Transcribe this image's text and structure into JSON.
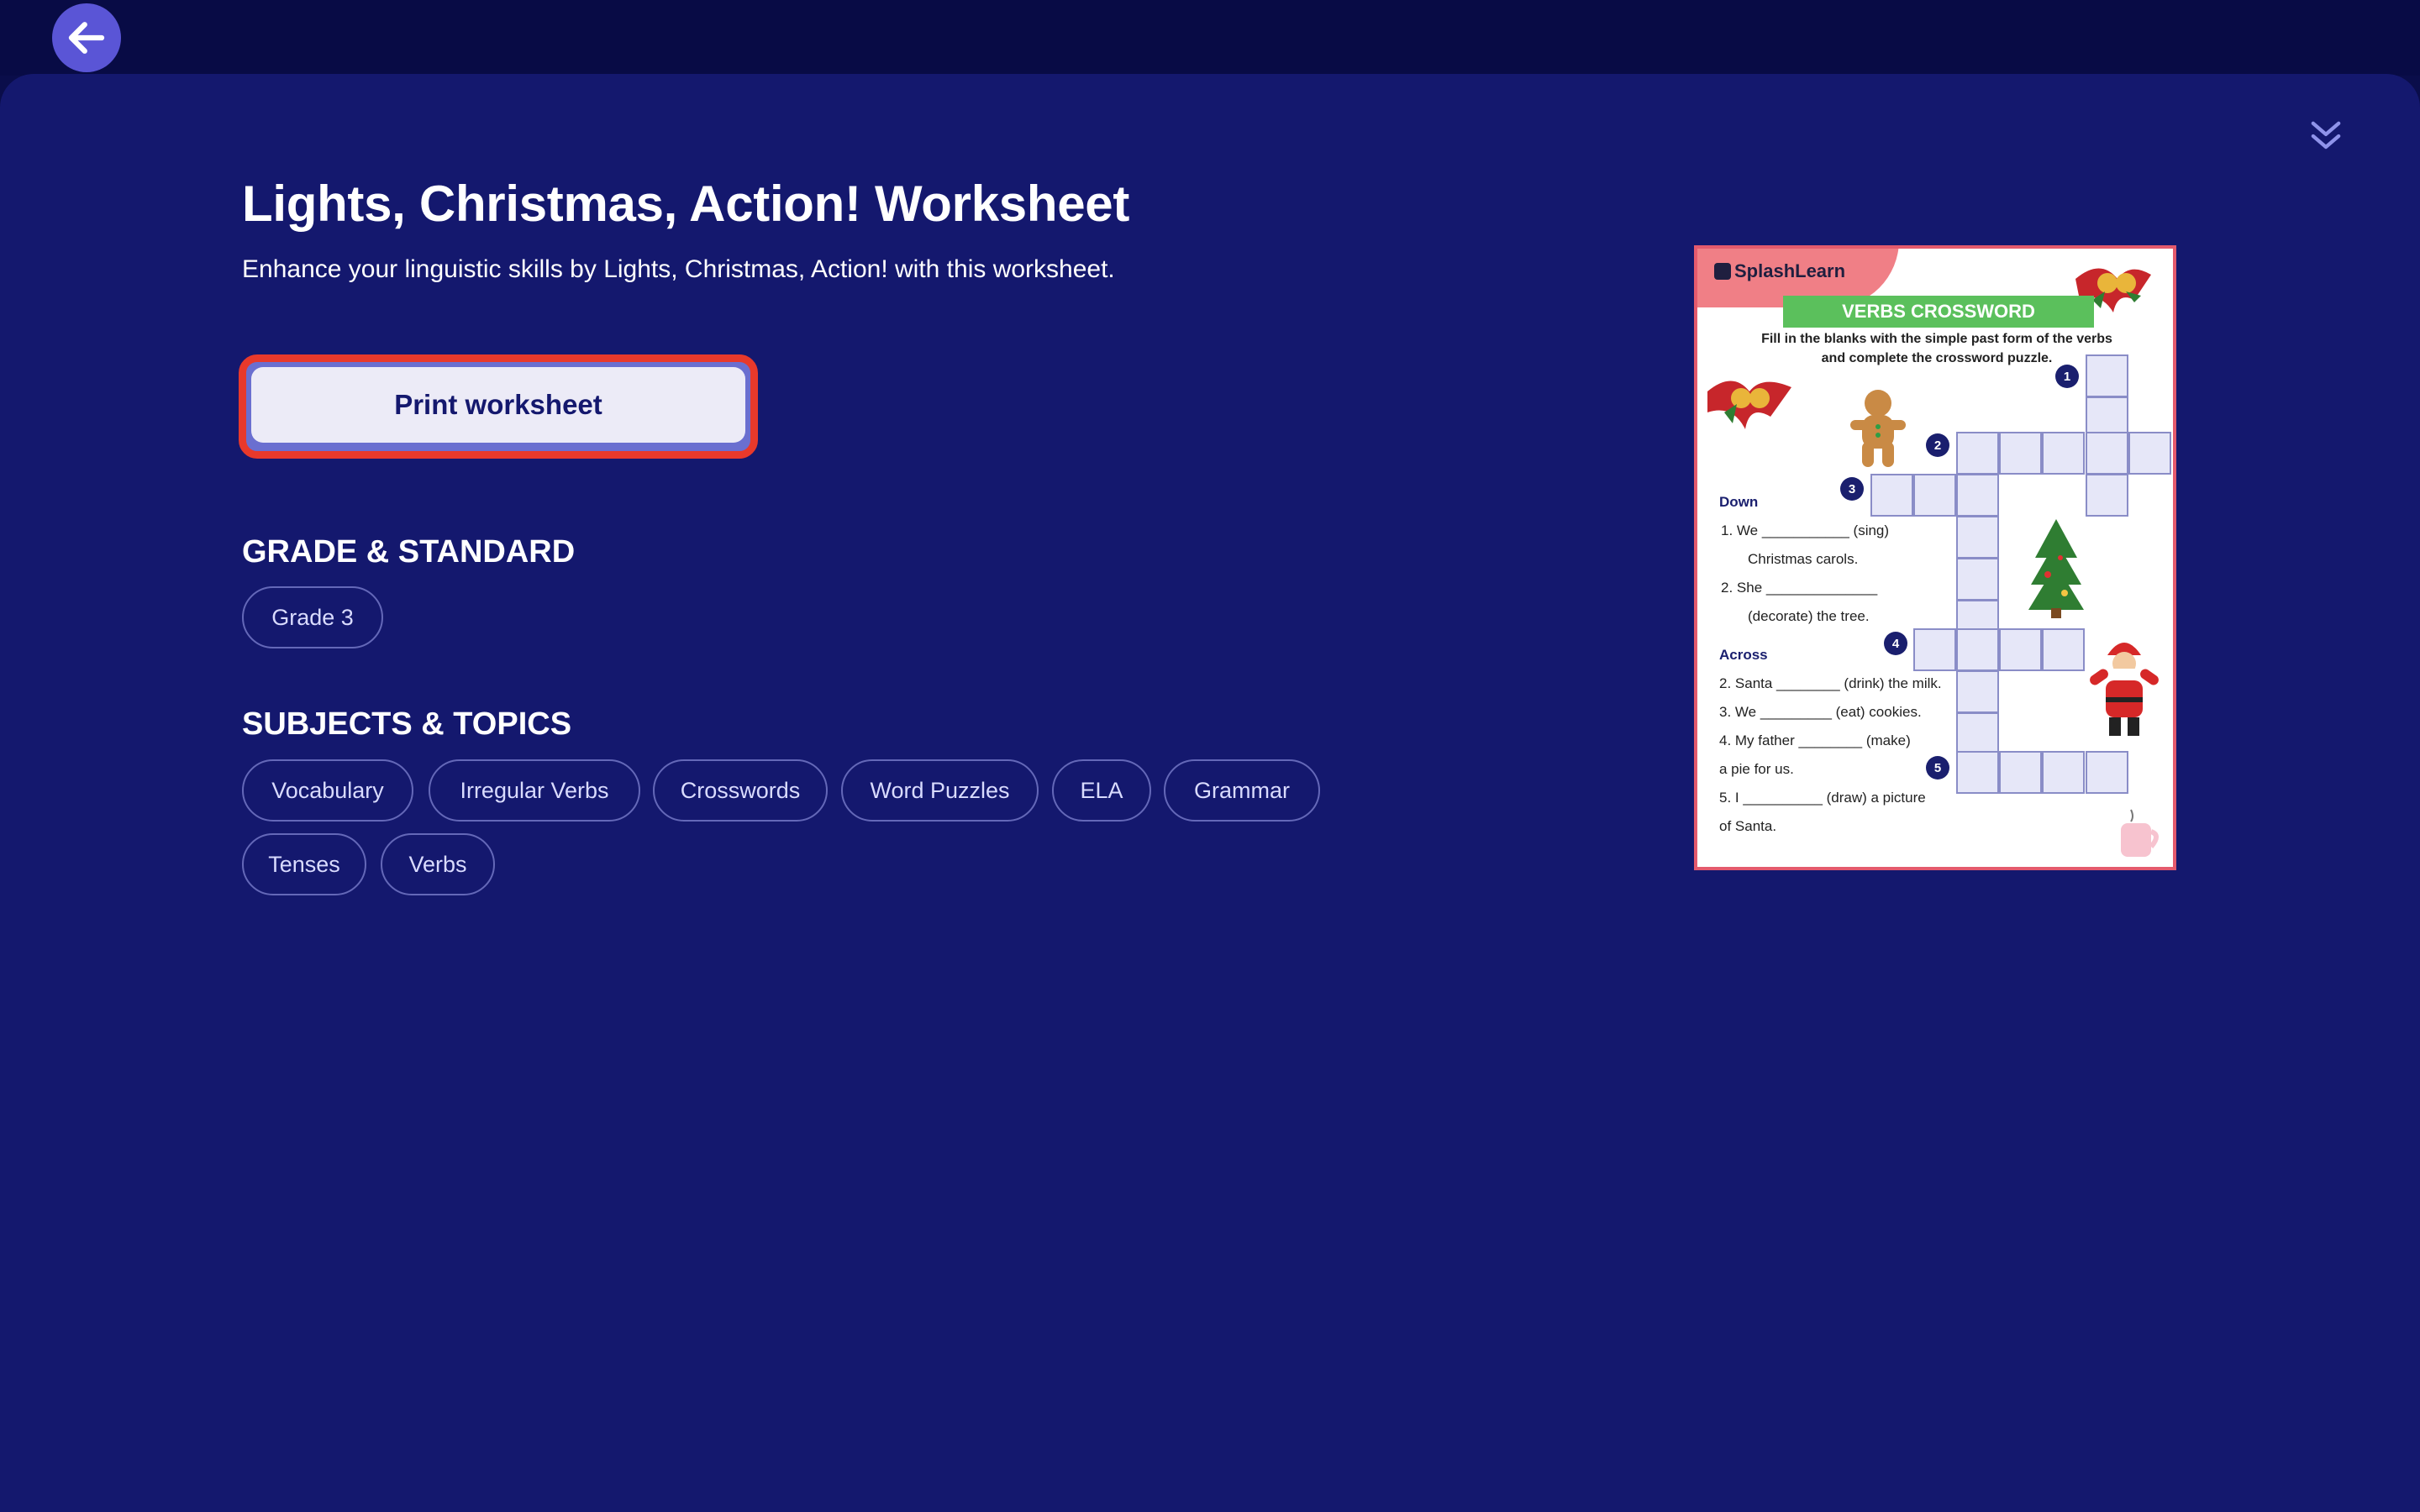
{
  "header": {
    "back_icon": "arrow-left-icon"
  },
  "panel": {
    "collapse_icon": "double-chevron-down-icon"
  },
  "worksheet": {
    "title": "Lights, Christmas, Action! Worksheet",
    "description": "Enhance your linguistic skills by Lights, Christmas, Action! with this worksheet.",
    "print_label": "Print worksheet"
  },
  "grade_section": {
    "heading": "GRADE & STANDARD",
    "chips": [
      "Grade 3"
    ]
  },
  "subjects_section": {
    "heading": "SUBJECTS & TOPICS",
    "chips": [
      "Vocabulary",
      "Irregular Verbs",
      "Crosswords",
      "Word Puzzles",
      "ELA",
      "Grammar",
      "Tenses",
      "Verbs"
    ]
  },
  "preview": {
    "brand": "SplashLearn",
    "banner": "VERBS CROSSWORD",
    "instructions": "Fill in the blanks with the simple past form of the verbs and complete the crossword puzzle.",
    "down_heading": "Down",
    "down_clues": [
      "1.   We ___________  (sing)",
      "Christmas carols.",
      "2.   She ______________",
      "(decorate) the tree."
    ],
    "across_heading": "Across",
    "across_clues": [
      "2. Santa ________ (drink) the milk.",
      "3. We _________ (eat) cookies.",
      "4. My father ________ (make)",
      "a pie for us.",
      "5. I __________ (draw) a picture",
      "of Santa."
    ],
    "numbers": [
      "1",
      "2",
      "3",
      "4",
      "5"
    ]
  },
  "colors": {
    "background": "#14186e",
    "topbar": "#080b45",
    "accent_button": "#5a55d6",
    "print_outline": "#e8392b",
    "chip_border": "#6468b8"
  }
}
